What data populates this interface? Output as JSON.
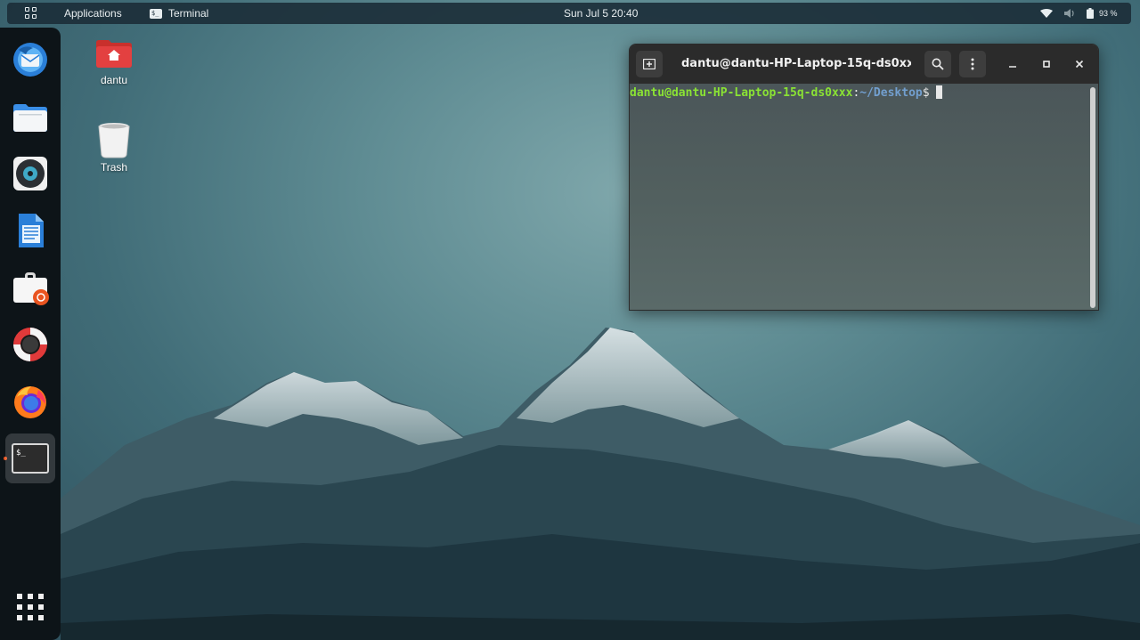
{
  "topbar": {
    "activities_icon": "app-grid-icon",
    "applications": "Applications",
    "focused_app": "Terminal",
    "focused_app_icon": "terminal-small-icon",
    "clock": "Sun Jul 5  20:40",
    "battery": "93 %",
    "wifi_icon": "wifi-icon",
    "volume_icon": "volume-icon",
    "battery_icon": "battery-icon"
  },
  "dock": {
    "items": [
      {
        "name": "thunderbird-icon"
      },
      {
        "name": "files-icon"
      },
      {
        "name": "rhythmbox-icon"
      },
      {
        "name": "libreoffice-writer-icon"
      },
      {
        "name": "ubuntu-software-icon"
      },
      {
        "name": "help-icon"
      },
      {
        "name": "firefox-icon"
      },
      {
        "name": "terminal-icon",
        "active": true
      }
    ],
    "show_apps_icon": "show-applications-icon"
  },
  "desktop": {
    "icons": [
      {
        "label": "dantu",
        "icon": "home-folder-icon"
      },
      {
        "label": "Trash",
        "icon": "trash-icon"
      }
    ]
  },
  "terminal": {
    "title": "dantu@dantu-HP-Laptop-15q-ds0xx...",
    "prompt_user": "dantu@dantu-HP-Laptop-15q-ds0xxx",
    "prompt_sep": ":",
    "prompt_path": "~/Desktop",
    "prompt_symbol": "$"
  },
  "colors": {
    "topbar_bg": "#1c2f3a",
    "dock_bg": "#0d1418",
    "prompt_user": "#8ae234",
    "prompt_path": "#729fcf",
    "accent": "#e95420"
  }
}
